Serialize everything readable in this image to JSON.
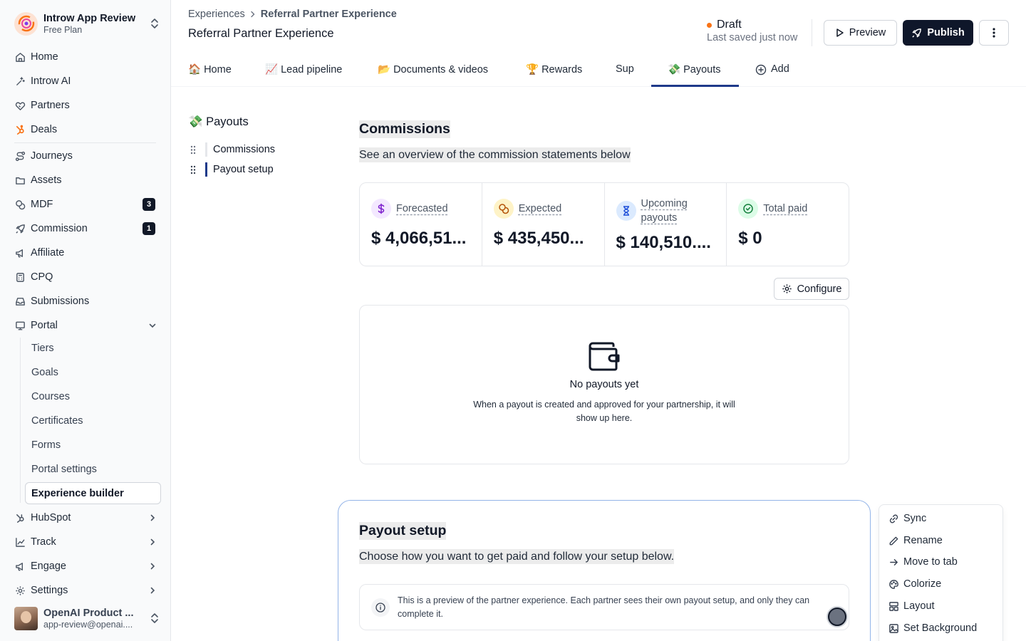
{
  "workspace": {
    "name": "Introw App Review",
    "plan": "Free Plan"
  },
  "sidebar": {
    "items": [
      {
        "label": "Home",
        "icon": "home-icon"
      },
      {
        "label": "Introw AI",
        "icon": "sparkle-icon"
      },
      {
        "label": "Partners",
        "icon": "handshake-icon"
      },
      {
        "label": "Deals",
        "icon": "hubspot-icon"
      },
      {
        "label": "Journeys",
        "icon": "route-icon"
      },
      {
        "label": "Assets",
        "icon": "folder-icon"
      },
      {
        "label": "MDF",
        "icon": "coins-icon",
        "badge": "3"
      },
      {
        "label": "Commission",
        "icon": "rocket-icon",
        "badge": "1"
      },
      {
        "label": "Affiliate",
        "icon": "megaphone-icon"
      },
      {
        "label": "CPQ",
        "icon": "calculator-icon"
      },
      {
        "label": "Submissions",
        "icon": "inbox-icon"
      },
      {
        "label": "Portal",
        "icon": "monitor-icon"
      }
    ],
    "portal_sub": [
      "Tiers",
      "Goals",
      "Courses",
      "Certificates",
      "Forms",
      "Portal settings",
      "Experience builder"
    ],
    "bottom": [
      {
        "label": "HubSpot",
        "icon": "hubspot-icon"
      },
      {
        "label": "Track",
        "icon": "chart-icon"
      },
      {
        "label": "Engage",
        "icon": "megaphone-icon"
      },
      {
        "label": "Settings",
        "icon": "gear-icon"
      }
    ]
  },
  "user": {
    "name": "OpenAI Product ...",
    "email": "app-review@openai...."
  },
  "header": {
    "breadcrumb": [
      "Experiences",
      "Referral Partner Experience"
    ],
    "title": "Referral Partner Experience",
    "status": "Draft",
    "saved": "Last saved just now",
    "preview_label": "Preview",
    "publish_label": "Publish"
  },
  "tabs": [
    {
      "label": "🏠 Home"
    },
    {
      "label": "📈 Lead pipeline"
    },
    {
      "label": "📂 Documents & videos"
    },
    {
      "label": "🏆 Rewards"
    },
    {
      "label": "Sup"
    },
    {
      "label": "💸 Payouts"
    },
    {
      "label": "Add"
    }
  ],
  "section_nav": {
    "title": "💸 Payouts",
    "items": [
      "Commissions",
      "Payout setup"
    ]
  },
  "commissions": {
    "heading": "Commissions",
    "subheading": "See an overview of the commission statements below",
    "cards": [
      {
        "label": "Forecasted",
        "value": "$ 4,066,51...",
        "icon": "dollar-icon",
        "color": "#f3e8ff",
        "icon_color": "#7e22ce"
      },
      {
        "label": "Expected",
        "value": "$ 435,450...",
        "icon": "coins-icon",
        "color": "#fef3c7",
        "icon_color": "#b45309"
      },
      {
        "label": "Upcoming payouts",
        "value": "$ 140,510....",
        "icon": "hourglass-icon",
        "color": "#dbeafe",
        "icon_color": "#1d4ed8"
      },
      {
        "label": "Total paid",
        "value": "$ 0",
        "icon": "check-circle-icon",
        "color": "#dcfce7",
        "icon_color": "#15803d"
      }
    ],
    "configure_label": "Configure",
    "empty_title": "No payouts yet",
    "empty_desc": "When a payout is created and approved for your partnership, it will show up here."
  },
  "payout_setup": {
    "heading": "Payout setup",
    "subheading": "Choose how you want to get paid and follow your setup below.",
    "info": "This is a preview of the partner experience. Each partner sees their own payout setup, and only they can complete it."
  },
  "context_menu": [
    "Sync",
    "Rename",
    "Move to tab",
    "Colorize",
    "Layout",
    "Set Background"
  ],
  "colors": {
    "accent": "#1e3a8a",
    "publish_bg": "#0f172a",
    "draft_dot": "#f97316"
  }
}
